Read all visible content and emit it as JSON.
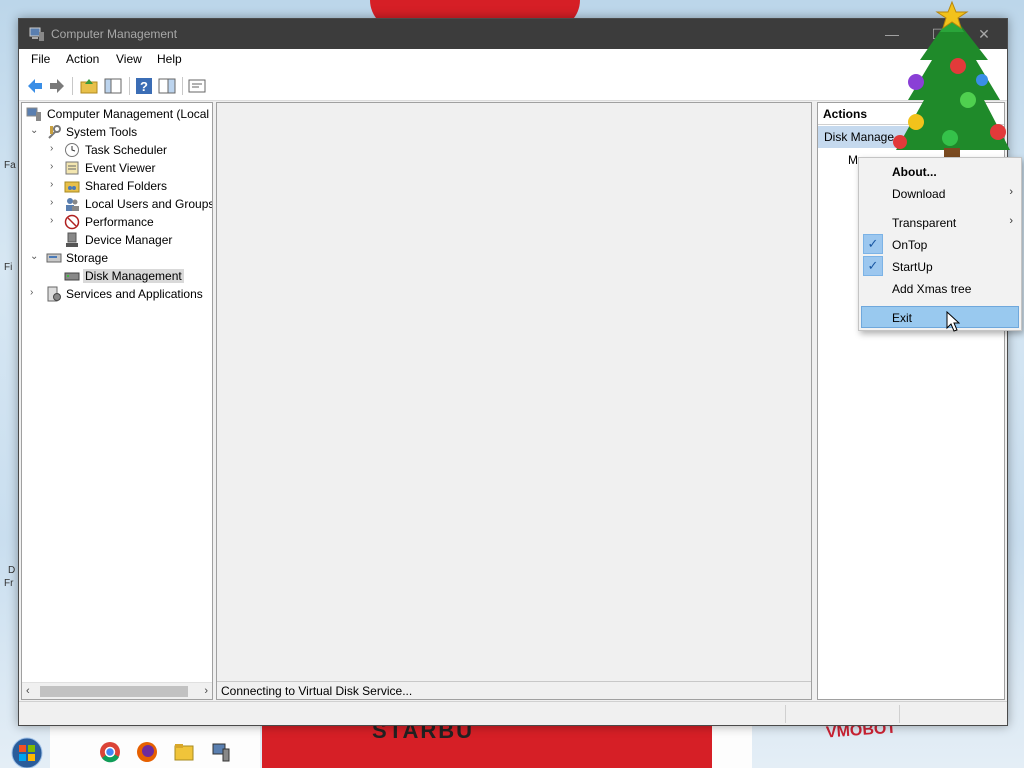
{
  "window": {
    "title": "Computer Management",
    "controls": {
      "minimize": "—",
      "maximize": "☐",
      "close": "✕"
    }
  },
  "menu": {
    "items": [
      "File",
      "Action",
      "View",
      "Help"
    ]
  },
  "toolbar": {
    "buttons": [
      "back-arrow-icon",
      "forward-arrow-icon",
      "up-folder-icon",
      "show-hide-tree-icon",
      "help-icon",
      "console-tree-icon",
      "properties-icon"
    ]
  },
  "tree": {
    "root": "Computer Management (Local",
    "system_tools": "System Tools",
    "task_scheduler": "Task Scheduler",
    "event_viewer": "Event Viewer",
    "shared_folders": "Shared Folders",
    "local_users": "Local Users and Groups",
    "performance": "Performance",
    "device_manager": "Device Manager",
    "storage": "Storage",
    "disk_management": "Disk Management",
    "services": "Services and Applications"
  },
  "center": {
    "status": "Connecting to Virtual Disk Service..."
  },
  "actions": {
    "header": "Actions",
    "selected": "Disk Manage",
    "more": "M"
  },
  "context_menu": {
    "about": "About...",
    "download": "Download",
    "transparent": "Transparent",
    "ontop": "OnTop",
    "startup": "StartUp",
    "add_tree": "Add Xmas tree",
    "exit": "Exit",
    "ontop_checked": true,
    "startup_checked": true,
    "check_glyph": "✓",
    "submenu_glyph": "›"
  },
  "desktop": {
    "label_1": "Fa",
    "label_2": "Fi",
    "label_3": "D",
    "label_4": "Fr",
    "bottom_text": "STARBU",
    "bottom_text_right": "VMOBOT"
  },
  "taskbar": {
    "icons": [
      "start-orb-icon",
      "chrome-icon",
      "firefox-icon",
      "file-explorer-icon",
      "computer-management-icon"
    ]
  },
  "colors": {
    "titlebar": "#3c3c3c",
    "selection": "#c5d9ee",
    "menu_hover": "#99c9ef",
    "check_bg": "#9cc7ef",
    "desktop_red": "#d61f26"
  }
}
